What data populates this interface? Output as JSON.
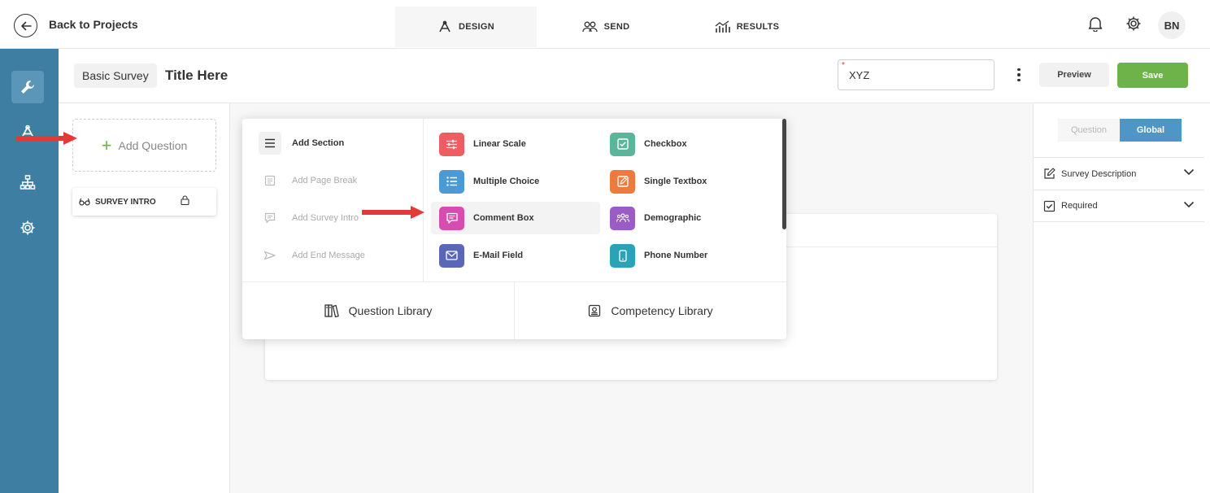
{
  "topbar": {
    "back_label": "Back to Projects",
    "tabs": [
      {
        "label": "DESIGN",
        "icon": "design-icon",
        "active": true
      },
      {
        "label": "SEND",
        "icon": "users-icon",
        "active": false
      },
      {
        "label": "RESULTS",
        "icon": "results-chart-icon",
        "active": false
      }
    ],
    "user_initials": "BN"
  },
  "header": {
    "survey_type": "Basic Survey",
    "title": "Title Here",
    "code_value": "XYZ",
    "preview_label": "Preview",
    "save_label": "Save"
  },
  "left_panel": {
    "add_question_label": "Add Question",
    "intro_label": "SURVEY INTRO"
  },
  "dropdown": {
    "sections": [
      {
        "label": "Add Section",
        "icon": "menu-lines-icon",
        "enabled": true
      },
      {
        "label": "Add Page Break",
        "icon": "page-break-icon",
        "enabled": false
      },
      {
        "label": "Add Survey Intro",
        "icon": "intro-icon",
        "enabled": false
      },
      {
        "label": "Add End Message",
        "icon": "flag-icon",
        "enabled": false
      }
    ],
    "question_types": [
      {
        "label": "Linear Scale",
        "icon": "sliders-icon",
        "color": "#ee5e61"
      },
      {
        "label": "Checkbox",
        "icon": "checkbox-icon",
        "color": "#5bb599"
      },
      {
        "label": "Multiple Choice",
        "icon": "list-icon",
        "color": "#4b9ad4"
      },
      {
        "label": "Single Textbox",
        "icon": "edit-box-icon",
        "color": "#ef7a3d"
      },
      {
        "label": "Comment Box",
        "icon": "comment-icon",
        "color": "#d64cb0"
      },
      {
        "label": "Demographic",
        "icon": "people-icon",
        "color": "#9b5cc4"
      },
      {
        "label": "E-Mail Field",
        "icon": "envelope-icon",
        "color": "#5a67b6"
      },
      {
        "label": "Phone Number",
        "icon": "phone-icon",
        "color": "#2ba3b6"
      }
    ],
    "libraries": [
      {
        "label": "Question Library",
        "icon": "books-icon"
      },
      {
        "label": "Competency Library",
        "icon": "badge-icon"
      }
    ]
  },
  "right_panel": {
    "tabs": [
      {
        "label": "Question",
        "active": false
      },
      {
        "label": "Global",
        "active": true
      }
    ],
    "accordions": [
      {
        "label": "Survey Description",
        "icon": "edit-icon"
      },
      {
        "label": "Required",
        "icon": "checkbox-icon"
      }
    ]
  },
  "colors": {
    "rail": "#3f7ea3",
    "save": "#6db34a",
    "accent": "#4f96c6",
    "annotation_arrow": "#e53935"
  }
}
